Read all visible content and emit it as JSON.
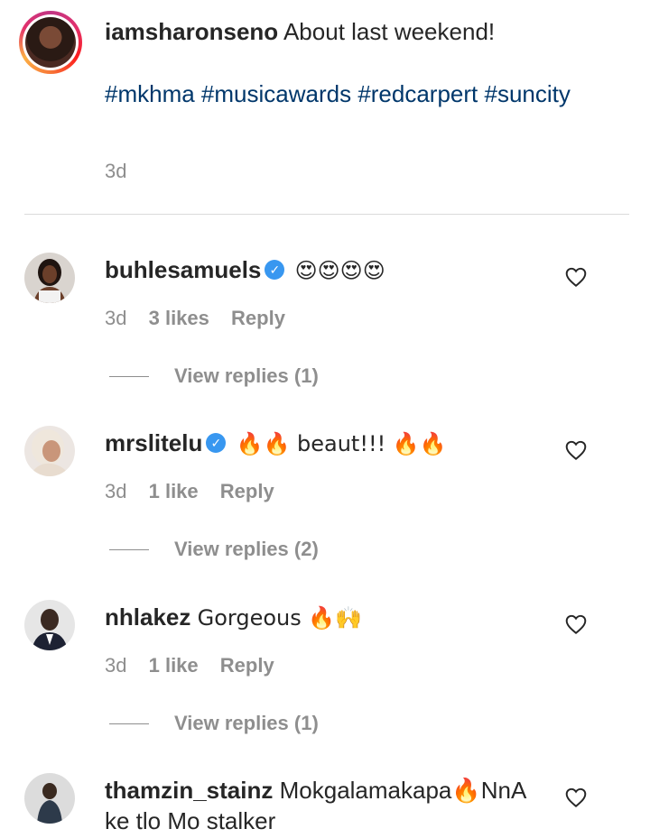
{
  "caption": {
    "username": "iamsharonseno",
    "text": "About last weekend!",
    "hashtags": "#mkhma #musicawards #redcarpert #suncity",
    "time": "3d"
  },
  "comments": [
    {
      "username": "buhlesamuels",
      "verified": true,
      "text": "😍😍😍😍",
      "time": "3d",
      "likes": "3 likes",
      "reply": "Reply",
      "view_replies": "View replies (1)"
    },
    {
      "username": "mrslitelu",
      "verified": true,
      "text": "🔥🔥 beaut!!! 🔥🔥",
      "time": "3d",
      "likes": "1 like",
      "reply": "Reply",
      "view_replies": "View replies (2)"
    },
    {
      "username": "nhlakez",
      "verified": false,
      "text": "Gorgeous 🔥🙌",
      "time": "3d",
      "likes": "1 like",
      "reply": "Reply",
      "view_replies": "View replies (1)"
    },
    {
      "username": "thamzin_stainz",
      "verified": false,
      "text": "Mokgalamakapa🔥NnA ke tlo Mo stalker"
    }
  ],
  "icons": {
    "heart": "heart-outline-icon",
    "verified": "verified-badge-icon"
  },
  "colors": {
    "hashtag": "#00376b",
    "muted": "#8e8e8e",
    "verified": "#3897f0"
  }
}
